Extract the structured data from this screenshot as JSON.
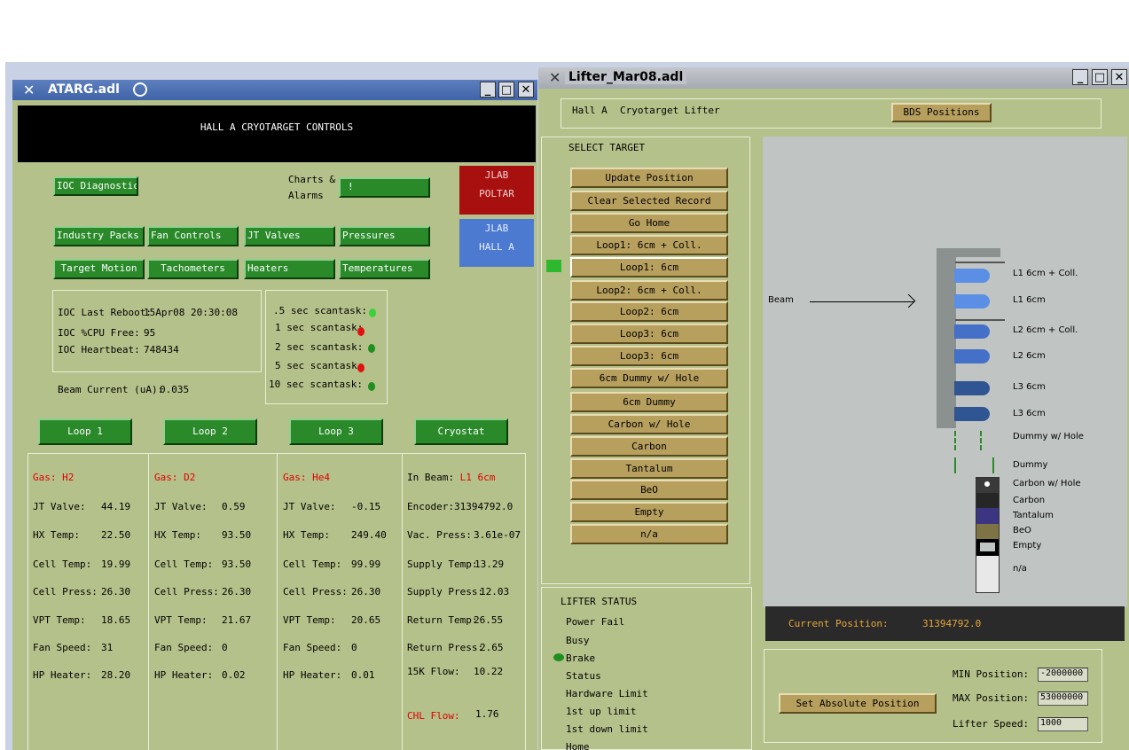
{
  "atarg": {
    "window_title": "ATARG.adl",
    "banner": "HALL A CRYOTARGET CONTROLS",
    "ioc_diagnostics": "IOC Diagnostics",
    "charts_label_1": "Charts &",
    "charts_label_2": "Alarms",
    "charts_button": "!",
    "jlab_poltar_1": "JLAB",
    "jlab_poltar_2": "POLTAR",
    "jlab_halla_1": "JLAB",
    "jlab_halla_2": "HALL A",
    "nav_buttons": [
      "Industry Packs",
      "Fan Controls",
      "JT Valves",
      "Pressures",
      "Target Motion",
      "Tachometers",
      "Heaters",
      "Temperatures"
    ],
    "ioc_info": {
      "last_reboot_label": "IOC Last Reboot:",
      "last_reboot": "15Apr08 20:30:08",
      "cpu_label": "IOC %CPU Free:",
      "cpu": "95",
      "heartbeat_label": "IOC Heartbeat:",
      "heartbeat": "748434"
    },
    "scantasks": [
      {
        "label": ".5 sec scantask:",
        "color": "#3ad13a"
      },
      {
        "label": "1 sec scantask:",
        "color": "#e01010"
      },
      {
        "label": "2 sec scantask:",
        "color": "#1f8f1f"
      },
      {
        "label": "5 sec scantask:",
        "color": "#e01010"
      },
      {
        "label": "10 sec scantask:",
        "color": "#1f8f1f"
      }
    ],
    "beam_current_label": "Beam Current (uA):",
    "beam_current": "0.035",
    "loop_buttons": [
      "Loop 1",
      "Loop 2",
      "Loop 3",
      "Cryostat"
    ],
    "loops": [
      {
        "gas_label": "Gas:",
        "gas": "H2",
        "rows": [
          [
            "JT Valve:",
            "44.19"
          ],
          [
            "HX Temp:",
            "22.50"
          ],
          [
            "Cell Temp:",
            "19.99"
          ],
          [
            "Cell Press:",
            "26.30"
          ],
          [
            "VPT Temp:",
            "18.65"
          ],
          [
            "Fan Speed:",
            "31"
          ],
          [
            "HP Heater:",
            "28.20"
          ]
        ]
      },
      {
        "gas_label": "Gas:",
        "gas": "D2",
        "rows": [
          [
            "JT Valve:",
            "0.59"
          ],
          [
            "HX Temp:",
            "93.50"
          ],
          [
            "Cell Temp:",
            "93.50"
          ],
          [
            "Cell Press:",
            "26.30"
          ],
          [
            "VPT Temp:",
            "21.67"
          ],
          [
            "Fan Speed:",
            "0"
          ],
          [
            "HP Heater:",
            "0.02"
          ]
        ]
      },
      {
        "gas_label": "Gas:",
        "gas": "He4",
        "rows": [
          [
            "JT Valve:",
            "-0.15"
          ],
          [
            "HX Temp:",
            "249.40"
          ],
          [
            "Cell Temp:",
            "99.99"
          ],
          [
            "Cell Press:",
            "26.30"
          ],
          [
            "VPT Temp:",
            "20.65"
          ],
          [
            "Fan Speed:",
            "0"
          ],
          [
            "HP Heater:",
            "0.01"
          ]
        ]
      }
    ],
    "cryostat": {
      "in_beam_label": "In Beam:",
      "in_beam": "L1 6cm",
      "rows": [
        [
          "Encoder:",
          "31394792.0"
        ],
        [
          "Vac. Press:",
          "3.61e-07"
        ],
        [
          "Supply Temp:",
          "13.29"
        ],
        [
          "Supply Press:",
          "12.03"
        ],
        [
          "Return Temp:",
          "26.55"
        ],
        [
          "Return Press:",
          "2.65"
        ],
        [
          "15K Flow:",
          "10.22"
        ]
      ],
      "chl_flow_label": "CHL Flow:",
      "chl_flow": "1.76"
    }
  },
  "lifter": {
    "window_title": "Lifter_Mar08.adl",
    "header_left": "Hall A",
    "header_title": "Cryotarget Lifter",
    "bds_button": "BDS Positions",
    "select_target_label": "SELECT TARGET",
    "target_buttons": [
      "Update Position",
      "Clear Selected Record",
      "Go Home",
      "Loop1: 6cm + Coll.",
      "Loop1: 6cm",
      "Loop2: 6cm + Coll.",
      "Loop2: 6cm",
      "Loop3: 6cm",
      "Loop3: 6cm",
      "6cm Dummy w/ Hole",
      "6cm Dummy",
      "Carbon w/ Hole",
      "Carbon",
      "Tantalum",
      "BeO",
      "Empty",
      "n/a"
    ],
    "beam_label": "Beam",
    "ladder_labels": [
      "L1 6cm + Coll.",
      "L1 6cm",
      "L2 6cm + Coll.",
      "L2 6cm",
      "L3 6cm",
      "L3 6cm",
      "Dummy w/ Hole",
      "Dummy",
      "Carbon w/ Hole",
      "Carbon",
      "Tantalum",
      "BeO",
      "Empty",
      "n/a"
    ],
    "current_position_label": "Current Position:",
    "current_position": "31394792.0",
    "status_title": "LIFTER STATUS",
    "status_items": [
      "Power Fail",
      "Busy",
      "Brake",
      "Status",
      "Hardware Limit",
      "1st up limit",
      "1st down limit",
      "Home"
    ],
    "set_absolute_button": "Set Absolute Position",
    "min_position_label": "MIN Position:",
    "min_position": "-2000000",
    "max_position_label": "MAX Position:",
    "max_position": "53000000",
    "lifter_speed_label": "Lifter Speed:",
    "lifter_speed": "1000"
  },
  "colors": {
    "window_bg": "#b5c18a",
    "green_button": "#2a8a2a",
    "tan_button": "#b79f5e",
    "titlebar_active": "#4a6db3",
    "ladder_blue_light": "#5b8fe6",
    "ladder_blue_dark": "#2f5592"
  }
}
